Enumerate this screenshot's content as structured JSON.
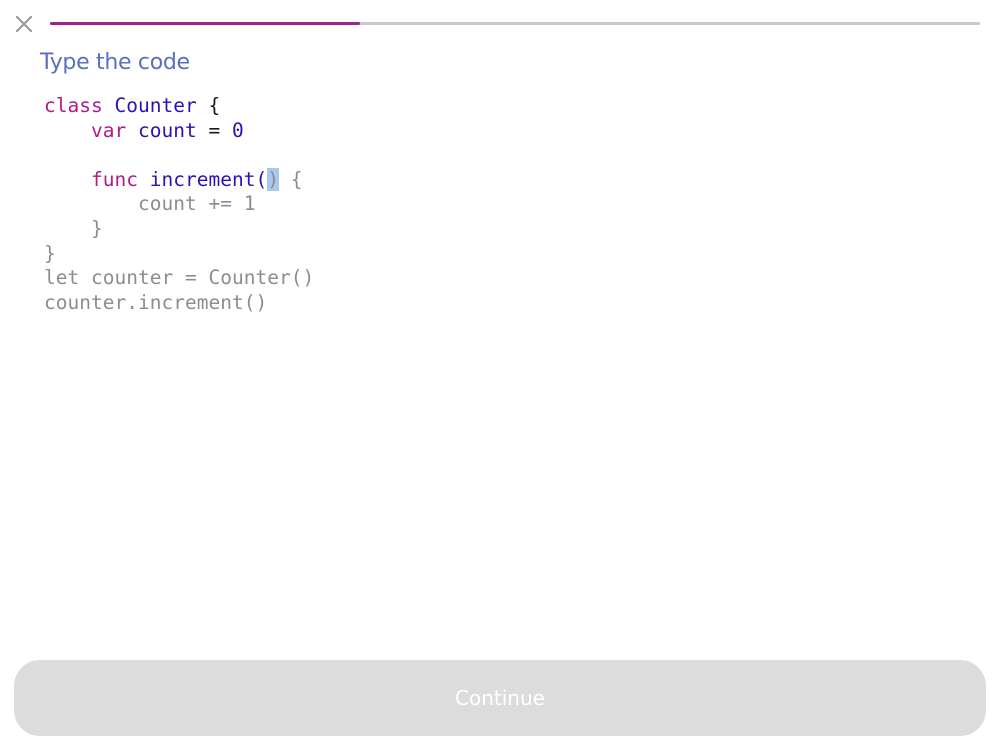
{
  "header": {
    "close_icon": "close-icon",
    "progress_fraction": 0.333
  },
  "main": {
    "title": "Type the code",
    "cursor_line": 3,
    "cursor_col": 19
  },
  "code_lines": [
    [
      {
        "t": "class ",
        "s": "kw"
      },
      {
        "t": "Counter",
        "s": "id"
      },
      {
        "t": " {",
        "s": "plain"
      }
    ],
    [
      {
        "t": "    ",
        "s": "plain"
      },
      {
        "t": "var ",
        "s": "kw"
      },
      {
        "t": "count",
        "s": "id"
      },
      {
        "t": " = ",
        "s": "plain"
      },
      {
        "t": "0",
        "s": "num"
      }
    ],
    [
      {
        "t": "",
        "s": "plain"
      }
    ],
    [
      {
        "t": "    ",
        "s": "plain"
      },
      {
        "t": "func ",
        "s": "kw"
      },
      {
        "t": "increment() {",
        "s": "id"
      }
    ],
    [
      {
        "t": "        count += 1",
        "s": "plain"
      }
    ],
    [
      {
        "t": "    }",
        "s": "plain"
      }
    ],
    [
      {
        "t": "}",
        "s": "plain"
      }
    ],
    [
      {
        "t": "let counter = Counter()",
        "s": "plain"
      }
    ],
    [
      {
        "t": "counter.increment()",
        "s": "plain"
      }
    ]
  ],
  "footer": {
    "continue_label": "Continue",
    "continue_enabled": false
  },
  "colors": {
    "close_icon": "#9a9a9a",
    "progress_fill": "#a0208e",
    "progress_track": "#c8c8c8",
    "title": "#5b6fbf",
    "keyword": "#ad1d87",
    "identifier": "#2814b4",
    "number": "#2814b4",
    "typed_plain": "#1a1a1a",
    "untyped": "#8d8d8d",
    "cursor_bg": "#a8c8f0",
    "button_bg": "#dcdcdc",
    "button_text": "#ffffff"
  }
}
